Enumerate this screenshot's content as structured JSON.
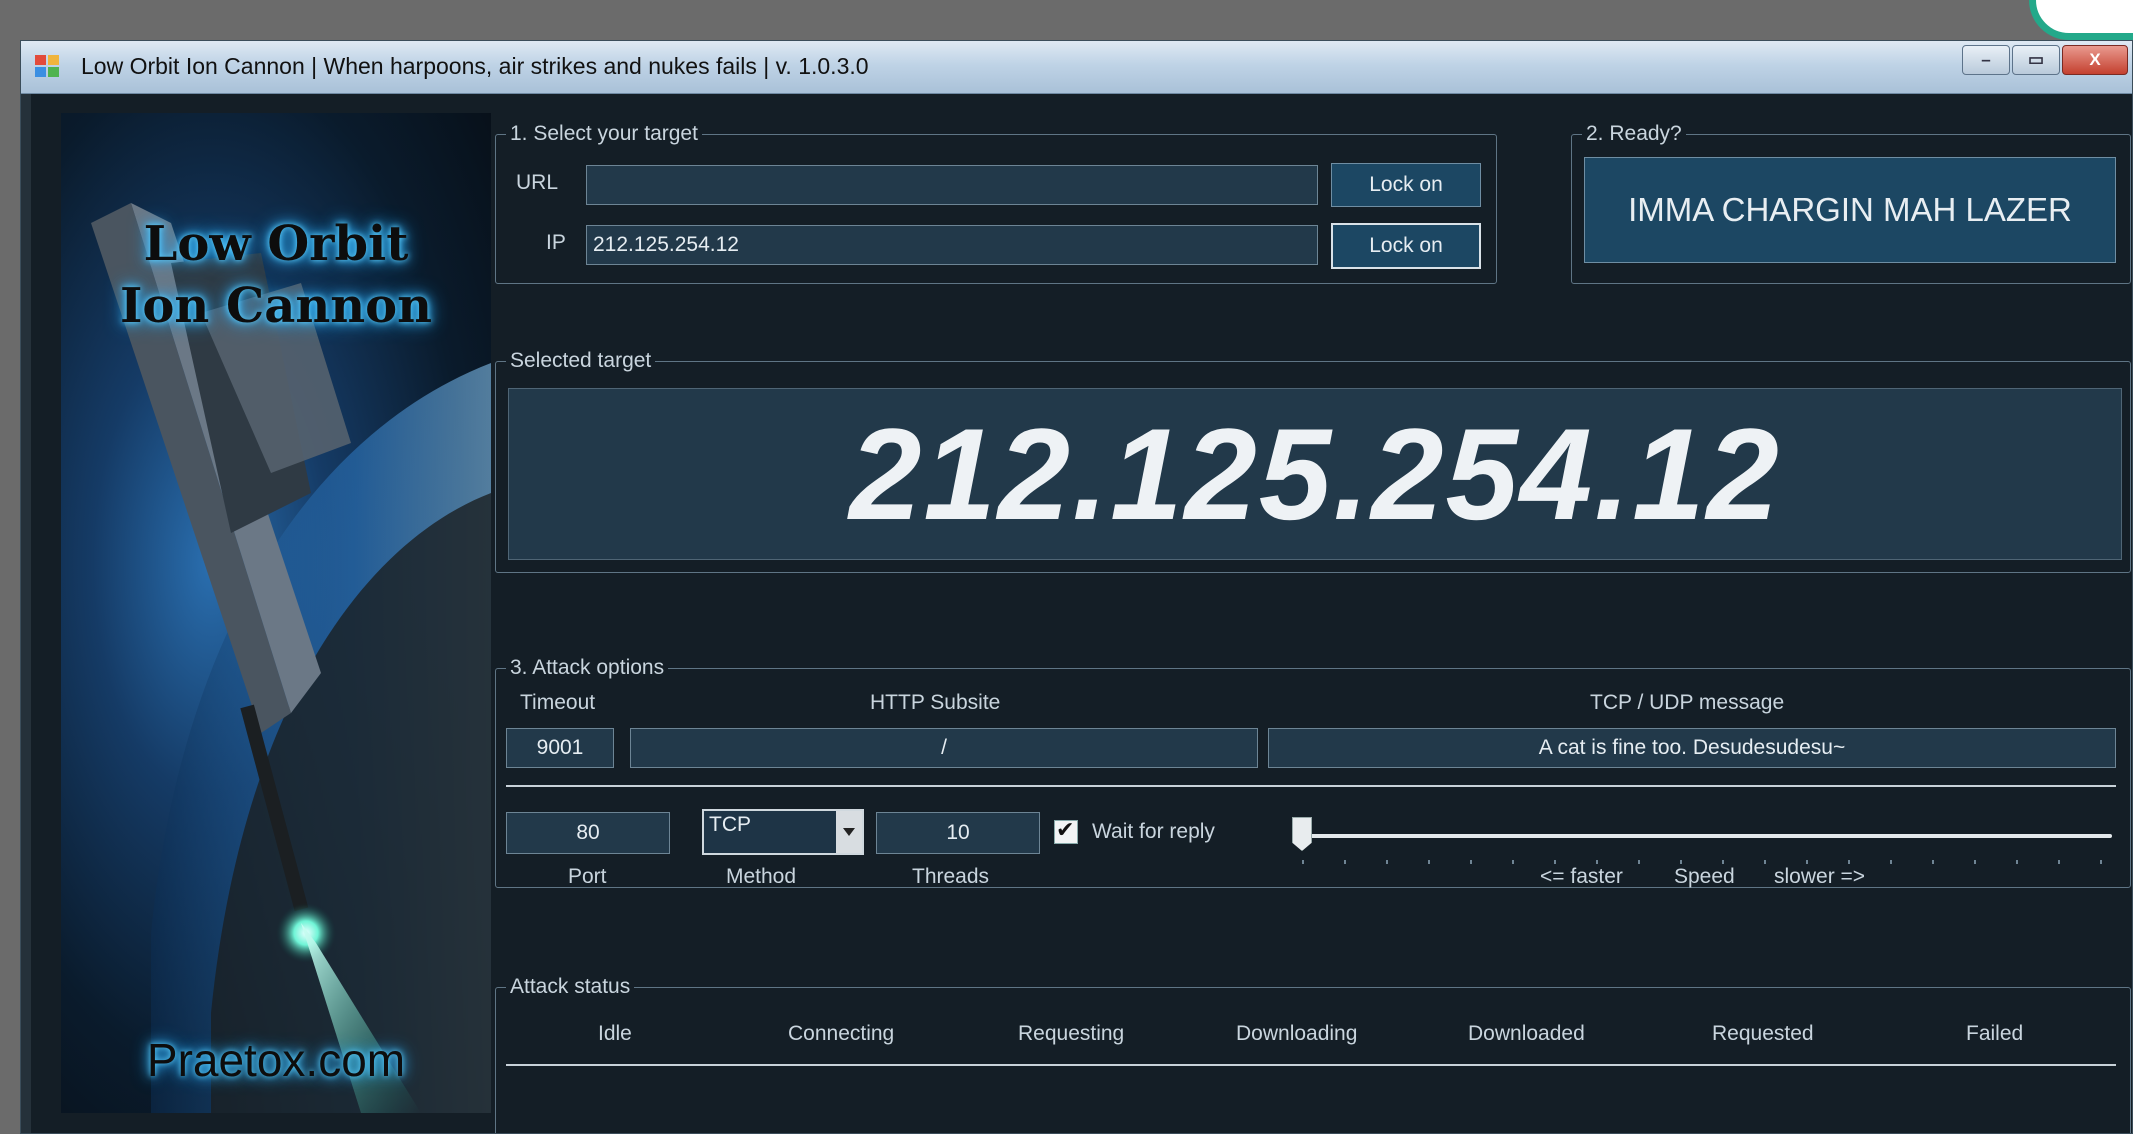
{
  "window": {
    "title": "Low Orbit Ion Cannon | When harpoons, air strikes and nukes fails | v. 1.0.3.0",
    "minimize_label": "–",
    "maximize_label": "▭",
    "close_label": "X"
  },
  "banner": {
    "title_line1": "Low Orbit",
    "title_line2": "Ion Cannon",
    "site": "Praetox.com"
  },
  "select_target": {
    "legend": "1. Select your target",
    "url_label": "URL",
    "url_value": "",
    "url_lock_label": "Lock on",
    "ip_label": "IP",
    "ip_value": "212.125.254.12",
    "ip_lock_label": "Lock on"
  },
  "ready": {
    "legend": "2. Ready?",
    "fire_label": "IMMA CHARGIN MAH LAZER"
  },
  "selected_target": {
    "legend": "Selected target",
    "value": "212.125.254.12"
  },
  "attack_options": {
    "legend": "3. Attack options",
    "timeout_label": "Timeout",
    "timeout_value": "9001",
    "subsite_label": "HTTP Subsite",
    "subsite_value": "/",
    "message_label": "TCP / UDP message",
    "message_value": "A cat is fine too. Desudesudesu~",
    "port_label": "Port",
    "port_value": "80",
    "method_label": "Method",
    "method_value": "TCP",
    "threads_label": "Threads",
    "threads_value": "10",
    "wait_label": "Wait for reply",
    "wait_checked": true,
    "checkmark": "✔",
    "speed_faster": "<= faster",
    "speed_label": "Speed",
    "speed_slower": "slower =>",
    "speed_level": 0
  },
  "attack_status": {
    "legend": "Attack status",
    "columns": [
      "Idle",
      "Connecting",
      "Requesting",
      "Downloading",
      "Downloaded",
      "Requested",
      "Failed"
    ]
  }
}
